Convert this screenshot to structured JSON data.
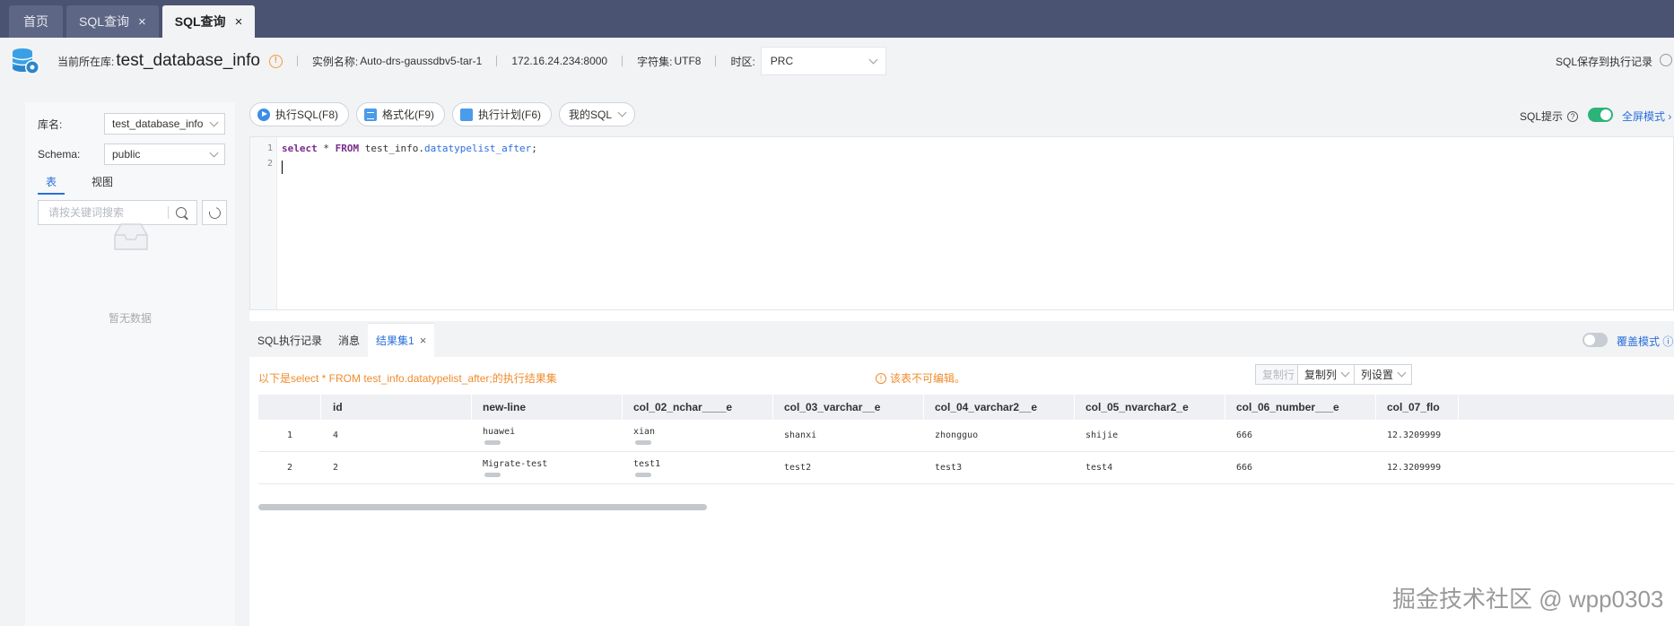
{
  "tabs": [
    {
      "label": "首页",
      "closable": false,
      "active": false
    },
    {
      "label": "SQL查询",
      "closable": true,
      "active": false
    },
    {
      "label": "SQL查询",
      "closable": true,
      "active": true
    }
  ],
  "info": {
    "current_db_label": "当前所在库:",
    "db_name": "test_database_info",
    "instance_label": "实例名称:",
    "instance_name": "Auto-drs-gaussdbv5-tar-1",
    "address": "172.16.24.234:8000",
    "charset_label": "字符集:",
    "charset": "UTF8",
    "timezone_label": "时区:",
    "timezone": "PRC",
    "sql_save_label": "SQL保存到执行记录"
  },
  "left": {
    "db_label": "库名:",
    "db_value": "test_database_info",
    "schema_label": "Schema:",
    "schema_value": "public",
    "tabs": [
      "表",
      "视图"
    ],
    "search_placeholder": "请按关键词搜索",
    "empty_text": "暂无数据"
  },
  "toolbar": {
    "execute": "执行SQL(F8)",
    "format": "格式化(F9)",
    "plan": "执行计划(F6)",
    "my_sql": "我的SQL",
    "sql_hint": "SQL提示",
    "fullscreen": "全屏模式",
    "sql_hint_enabled": true
  },
  "editor": {
    "lines": [
      "select * FROM test_info.datatypelist_after;",
      ""
    ],
    "line_numbers": [
      "1",
      "2"
    ]
  },
  "result": {
    "tabs": [
      "SQL执行记录",
      "消息",
      "结果集1"
    ],
    "cover_mode": "覆盖模式",
    "info_text": "以下是select * FROM test_info.datatypelist_after;的执行结果集",
    "warn_text": "该表不可编辑。",
    "btn_copy_row": "复制行",
    "btn_copy_col": "复制列",
    "btn_col_settings": "列设置",
    "columns": [
      "",
      "id",
      "new-line",
      "col_02_nchar____e",
      "col_03_varchar__e",
      "col_04_varchar2__e",
      "col_05_nvarchar2_e",
      "col_06_number___e",
      "col_07_flo"
    ],
    "rows": [
      [
        "1",
        "4",
        "huawei",
        "xian",
        "shanxi",
        "zhongguo",
        "shijie",
        "666",
        "12.3209999"
      ],
      [
        "2",
        "2",
        "Migrate-test",
        "test1",
        "test2",
        "test3",
        "test4",
        "666",
        "12.3209999"
      ]
    ]
  },
  "watermark": "掘金技术社区 @ wpp0303",
  "colors": {
    "topbar": "#4a5372",
    "accent": "#2a6fdb",
    "warning": "#f08b2c",
    "toggle_on": "#2cb37a"
  }
}
